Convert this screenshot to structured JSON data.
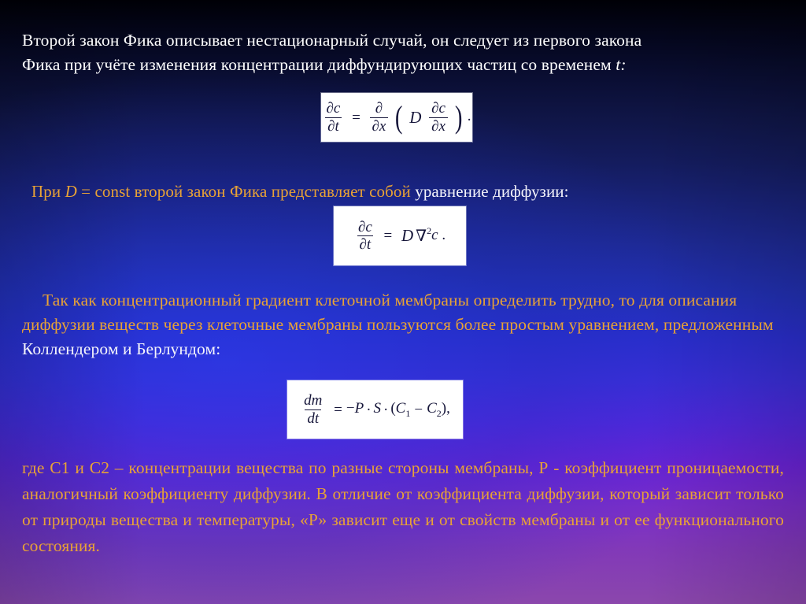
{
  "slide": {
    "background_top_color": "#000006",
    "background_mid_color": "#2230b4",
    "background_bottom_color": "#8b47ac",
    "gold_color": "#e8a236",
    "white_color": "#f4f4fb"
  },
  "paragraphs": {
    "intro": {
      "line1": "Второй закон Фика описывает нестационарный случай, он следует из первого закона",
      "line2_a": "Фика при учёте изменения концентрации диффундирующих частиц со временем ",
      "line2_italic": "t:"
    },
    "const_line": {
      "gold_a": "При ",
      "gold_italic": "D",
      "gold_b": " = const второй  закон Фика представляет собой ",
      "white": "уравнение диффузии:"
    },
    "gradient": {
      "text_gold": "Так как концентрационный градиент клеточной мембраны определить трудно, то для описания диффузии веществ через клеточные мембраны пользуются более простым уравнением, предложенным ",
      "text_white": "Коллендером и Берлундом:"
    },
    "where": {
      "text": "где С1 и С2 – концентрации вещества по разные стороны мембраны, Р - коэффициент проницаемости, аналогичный коэффициенту диффузии. В отличие от коэффициента диффузии, который зависит только от природы вещества и температуры, «Р» зависит еще и от свойств мембраны и от ее функционального состояния."
    }
  },
  "formulas": {
    "fick_second_general": {
      "alt": "∂c/∂t = ∂/∂x ( D ∂c/∂x ).",
      "num1": "∂c",
      "den1": "∂t",
      "equals": "=",
      "num2": "∂",
      "den2": "∂x",
      "paren_open": "(",
      "coefficient": "D",
      "num3": "∂c",
      "den3": "∂x",
      "paren_close": ")",
      "period": "."
    },
    "diffusion_equation": {
      "alt": "∂c/∂t = D ∇² c .",
      "num1": "∂c",
      "den1": "∂t",
      "equals": "=",
      "coefficient": "D",
      "nabla": "∇",
      "exponent": "2",
      "variable": "c",
      "period": "."
    },
    "collander_barlund": {
      "alt": "dm/dt = − P · S · (C1 − C2),",
      "num1": "dm",
      "den1": "dt",
      "equals": "=",
      "minus": "−",
      "p_symbol": "P",
      "dot1": "·",
      "s_symbol": "S",
      "dot2": "·",
      "paren_open": "(",
      "c_symbol": "C",
      "sub1": "1",
      "operator": "−",
      "c_symbol2": "C",
      "sub2": "2",
      "paren_close": ")",
      "comma": ","
    }
  }
}
